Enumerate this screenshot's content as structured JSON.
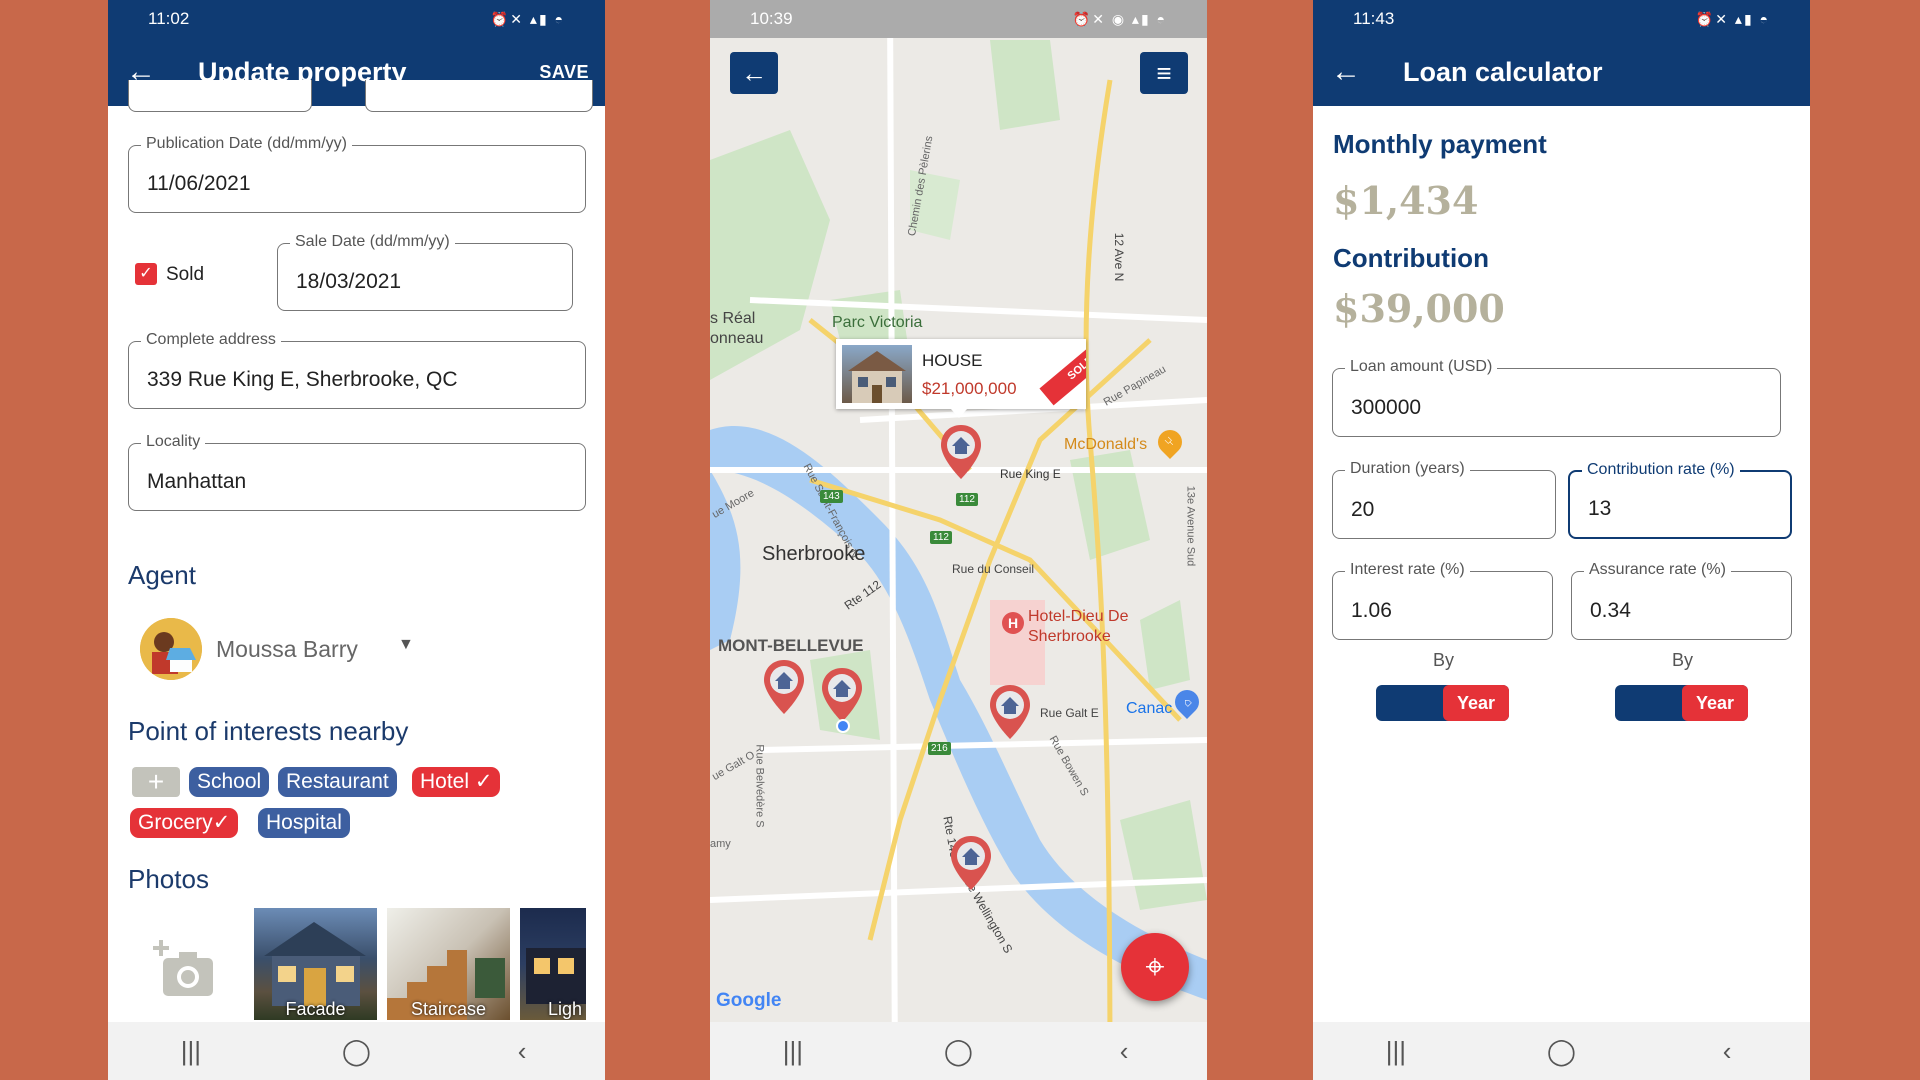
{
  "phone1": {
    "status_time": "11:02",
    "appbar": {
      "title": "Update property",
      "save": "SAVE"
    },
    "pub_date": {
      "label": "Publication Date (dd/mm/yy)",
      "value": "11/06/2021"
    },
    "sold_label": "Sold",
    "sale_date": {
      "label": "Sale Date (dd/mm/yy)",
      "value": "18/03/2021"
    },
    "address": {
      "label": "Complete address",
      "value": "339 Rue King E, Sherbrooke, QC"
    },
    "locality": {
      "label": "Locality",
      "value": "Manhattan"
    },
    "agent_heading": "Agent",
    "agent_name": "Moussa Barry",
    "poi_heading": "Point of interests nearby",
    "chips": [
      "School",
      "Restaurant",
      "Hotel",
      "Grocery",
      "Hospital"
    ],
    "photos_heading": "Photos",
    "photos": [
      "Facade",
      "Staircase",
      "Ligh"
    ]
  },
  "phone2": {
    "status_time": "10:39",
    "callout": {
      "type": "HOUSE",
      "price": "$21,000,000",
      "badge": "SOLD"
    },
    "labels": {
      "parc": "Parc Victoria",
      "sherbrooke": "Sherbrooke",
      "montbellevue": "MONT-BELLEVUE",
      "mcdonalds": "McDonald's",
      "hotel_dieu_1": "Hotel-Dieu De",
      "hotel_dieu_2": "Sherbrooke",
      "canac": "Canac",
      "rue_king": "Rue King E",
      "rue_conseil": "Rue du Conseil",
      "rue_galt": "Rue Galt E",
      "rue_papineau": "Rue Papineau",
      "rte112": "Rte 112",
      "rte143": "Rte 143",
      "rue_wellington": "Rue Wellington S",
      "ave12": "12 Ave N",
      "ave13": "13e Avenue Sud",
      "sreal": "s Réal",
      "onneau": "onneau",
      "chemin": "Chemin des Pèlerins",
      "rue_belvedere": "Rue Belvédère S",
      "rue_stfrancois": "Rue Saint-François N",
      "rue_bowen": "Rue Bowen S",
      "ue_moore": "ue Moore",
      "ue_galt_o": "ue Galt O",
      "amy": "amy",
      "shield143": "143",
      "shield112a": "112",
      "shield112b": "112",
      "shield216": "216",
      "google": "Google"
    }
  },
  "phone3": {
    "status_time": "11:43",
    "appbar": {
      "title": "Loan calculator"
    },
    "monthly_heading": "Monthly payment",
    "monthly_value": "$1,434",
    "contribution_heading": "Contribution",
    "contribution_value": "$39,000",
    "loan": {
      "label": "Loan amount (USD)",
      "value": "300000"
    },
    "duration": {
      "label": "Duration (years)",
      "value": "20"
    },
    "contrib_rate": {
      "label": "Contribution rate (%)",
      "value": "13"
    },
    "interest": {
      "label": "Interest rate (%)",
      "value": "1.06"
    },
    "assurance": {
      "label": "Assurance rate (%)",
      "value": "0.34"
    },
    "by_label": "By",
    "toggle_label": "Year"
  },
  "colors": {
    "primary": "#0f3b73",
    "accent": "#e53238",
    "chip_blue": "#3d5fa0",
    "muted_value": "#b5b19c",
    "background": "#C8684A"
  }
}
